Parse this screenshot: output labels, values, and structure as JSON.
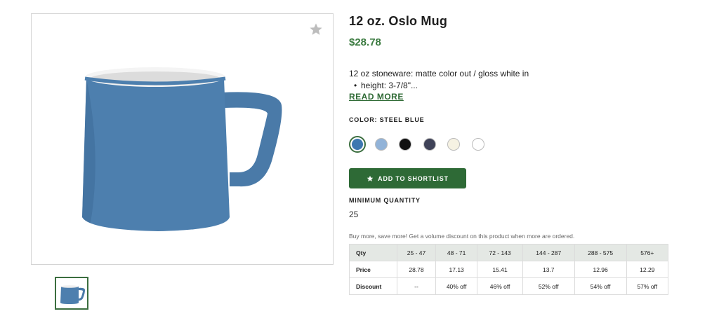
{
  "product": {
    "title": "12 oz. Oslo Mug",
    "price": "$28.78",
    "description": "12 oz stoneware: matte color out / gloss white in",
    "bullet": "height: 3-7/8\"...",
    "read_more": "READ MORE",
    "color_label": "COLOR: STEEL BLUE"
  },
  "swatches": [
    {
      "name": "steel-blue",
      "color": "#3d77b0",
      "selected": true
    },
    {
      "name": "light-blue",
      "color": "#92b3d8",
      "selected": false
    },
    {
      "name": "black",
      "color": "#111111",
      "selected": false
    },
    {
      "name": "navy",
      "color": "#3f4258",
      "selected": false
    },
    {
      "name": "cream",
      "color": "#f6f2e3",
      "selected": false
    },
    {
      "name": "white",
      "color": "#ffffff",
      "selected": false
    }
  ],
  "actions": {
    "add_to_shortlist": "ADD TO SHORTLIST"
  },
  "minimum": {
    "label": "MINIMUM QUANTITY",
    "value": "25"
  },
  "promo": "Buy more, save more! Get a volume discount on this product when more are ordered.",
  "pricing_table": {
    "headers": [
      "Qty",
      "25 - 47",
      "48 - 71",
      "72 - 143",
      "144 - 287",
      "288 - 575",
      "576+"
    ],
    "price_row": [
      "Price",
      "28.78",
      "17.13",
      "15.41",
      "13.7",
      "12.96",
      "12.29"
    ],
    "discount_row": [
      "Discount",
      "--",
      "40% off",
      "46% off",
      "52% off",
      "54% off",
      "57% off"
    ]
  },
  "icons": {
    "favorite": "star-icon",
    "button": "star-icon"
  },
  "colors": {
    "accent_green": "#2e6a36",
    "price_green": "#3a7a3f",
    "mug_blue": "#4a7aa8"
  }
}
